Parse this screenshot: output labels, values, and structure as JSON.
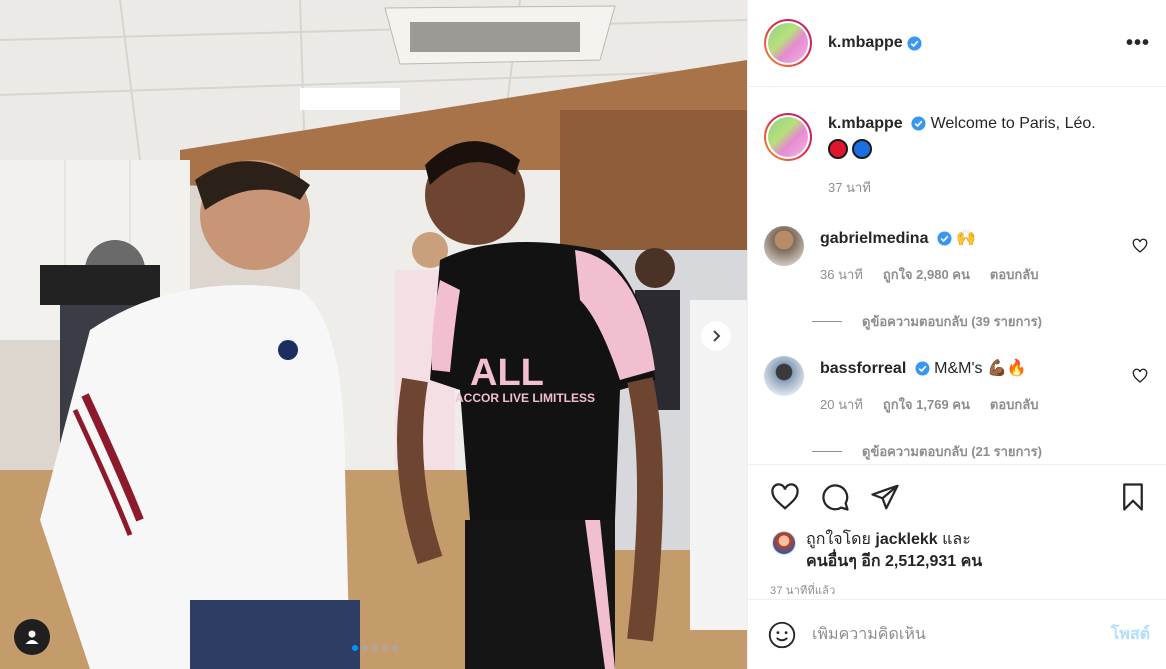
{
  "post": {
    "author": "k.mbappe",
    "caption_text": "Welcome to Paris, Léo.",
    "caption_time": "37 นาที",
    "photo_count": 5,
    "photo_active_index": 0
  },
  "comments": [
    {
      "username": "gabrielmedina",
      "text": "🙌",
      "time": "36 นาที",
      "likes": "ถูกใจ 2,980 คน",
      "reply": "ตอบกลับ",
      "view_replies": "ดูข้อความตอบกลับ (39 รายการ)"
    },
    {
      "username": "bassforreal",
      "text": "M&M's 💪🏾🔥",
      "time": "20 นาที",
      "likes": "ถูกใจ 1,769 คน",
      "reply": "ตอบกลับ",
      "view_replies": "ดูข้อความตอบกลับ (21 รายการ)"
    }
  ],
  "likes_summary": {
    "prefix": "ถูกใจโดย",
    "liked_by": "jacklekk",
    "and": "และ",
    "others": "คนอื่นๆ อีก 2,512,931 คน"
  },
  "post_time": "37 นาทีที่แล้ว",
  "add_comment": {
    "placeholder": "เพิ่มความคิดเห็น",
    "post_label": "โพสต์"
  },
  "icons": {
    "more": "more-options-icon",
    "heart": "heart-icon",
    "comment": "comment-icon",
    "share": "share-icon",
    "save": "bookmark-icon",
    "emoji": "emoji-icon",
    "next": "chevron-right-icon",
    "user_tag": "user-tag-icon",
    "verified": "verified-badge-icon"
  },
  "colors": {
    "accent": "#0095f6",
    "secondary_text": "#8e8e8e",
    "post_button_disabled": "#b2dffc",
    "border": "#efefef"
  }
}
